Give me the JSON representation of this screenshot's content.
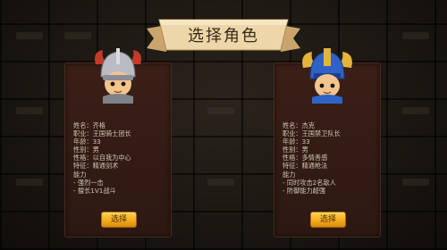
{
  "title": "选择角色",
  "colors": {
    "banner": "#e8cfa0",
    "card": "#3b1f17",
    "button": "#f3a91c",
    "text": "#cfc6b4"
  },
  "characters": [
    {
      "avatar_icon": "red-helmet-knight-icon",
      "lines": [
        "姓名：齐格",
        "职业：王国骑士团长",
        "年龄：33",
        "性别：男",
        "性格：以自我为中心",
        "特征：精通剑术",
        "能力",
        "- 强烈一击",
        "- 擅长1V1战斗"
      ],
      "button_label": "选择"
    },
    {
      "avatar_icon": "blue-helmet-guard-icon",
      "lines": [
        "姓名：杰克",
        "职业：王国禁卫队长",
        "年龄：33",
        "性别：男",
        "性格：多情善感",
        "特征：精通枪法",
        "能力",
        "- 同时攻击2名敌人",
        "- 防御能力超强"
      ],
      "button_label": "选择"
    }
  ]
}
